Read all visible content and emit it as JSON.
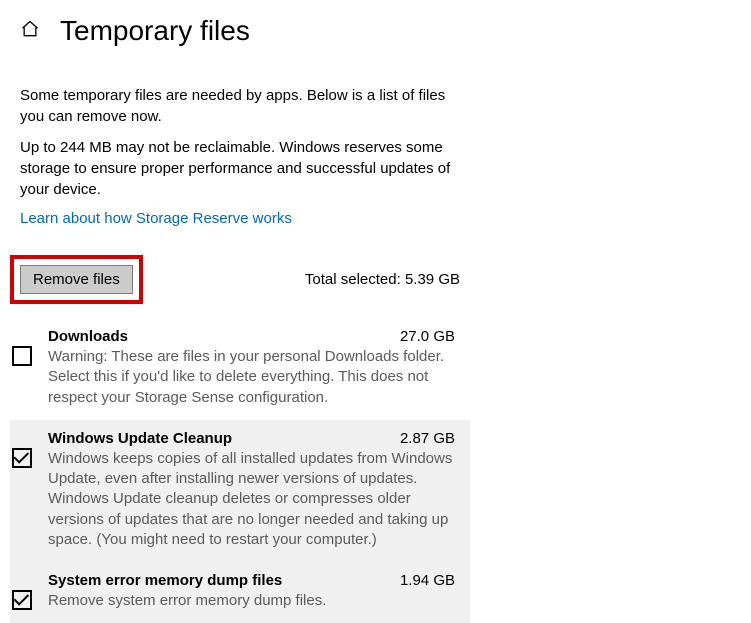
{
  "header": {
    "title": "Temporary files"
  },
  "intro": "Some temporary files are needed by apps. Below is a list of files you can remove now.",
  "reserve_note": "Up to 244 MB may not be reclaimable. Windows reserves some storage to ensure proper performance and successful updates of your device.",
  "learn_link": "Learn about how Storage Reserve works",
  "actions": {
    "remove_label": "Remove files",
    "total_prefix": "Total selected: ",
    "total_value": "5.39 GB"
  },
  "items": [
    {
      "title": "Downloads",
      "size": "27.0 GB",
      "desc": "Warning: These are files in your personal Downloads folder. Select this if you'd like to delete everything. This does not respect your Storage Sense configuration.",
      "checked": false
    },
    {
      "title": "Windows Update Cleanup",
      "size": "2.87 GB",
      "desc": "Windows keeps copies of all installed updates from Windows Update, even after installing newer versions of updates. Windows Update cleanup deletes or compresses older versions of updates that are no longer needed and taking up space. (You might need to restart your computer.)",
      "checked": true
    },
    {
      "title": "System error memory dump files",
      "size": "1.94 GB",
      "desc": "Remove system error memory dump files.",
      "checked": true
    }
  ]
}
